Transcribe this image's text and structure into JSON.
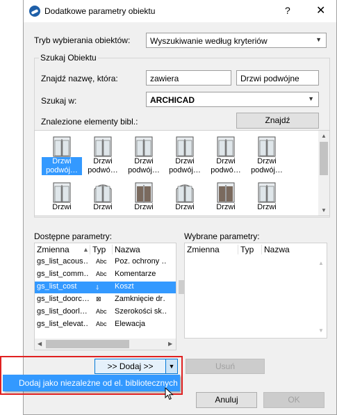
{
  "window": {
    "title": "Dodatkowe parametry obiektu",
    "help_label": "?",
    "close_label": "✕"
  },
  "selection_mode": {
    "label": "Tryb wybierania obiektów:",
    "value": "Wyszukiwanie według kryteriów"
  },
  "search_group": {
    "title": "Szukaj Obiektu",
    "find_name_label": "Znajdź nazwę, która:",
    "condition_value": "zawiera",
    "name_value": "Drzwi podwójne",
    "search_in_label": "Szukaj w:",
    "search_in_value": "ARCHICAD",
    "found_label": "Znalezione elementy bibl.:",
    "find_button": "Znajdź"
  },
  "library_items": [
    {
      "line1": "Drzwi",
      "line2": "podwój…",
      "selected": true,
      "icon": "double-door-icon"
    },
    {
      "line1": "Drzwi",
      "line2": "podwó…",
      "selected": false,
      "icon": "double-door-icon"
    },
    {
      "line1": "Drzwi",
      "line2": "podwój…",
      "selected": false,
      "icon": "double-door-icon"
    },
    {
      "line1": "Drzwi",
      "line2": "podwój…",
      "selected": false,
      "icon": "double-door-icon"
    },
    {
      "line1": "Drzwi",
      "line2": "podwó…",
      "selected": false,
      "icon": "double-door-icon"
    },
    {
      "line1": "Drzwi",
      "line2": "podwój…",
      "selected": false,
      "icon": "double-door-icon"
    },
    {
      "line1": "Drzwi",
      "line2": "",
      "selected": false,
      "icon": "double-door-icon"
    },
    {
      "line1": "Drzwi",
      "line2": "",
      "selected": false,
      "icon": "arched-door-icon"
    },
    {
      "line1": "Drzwi",
      "line2": "",
      "selected": false,
      "icon": "ornate-door-icon"
    },
    {
      "line1": "Drzwi",
      "line2": "",
      "selected": false,
      "icon": "arched-door-icon"
    },
    {
      "line1": "Drzwi",
      "line2": "",
      "selected": false,
      "icon": "ornate-door-icon"
    },
    {
      "line1": "Drzwi",
      "line2": "",
      "selected": false,
      "icon": "double-door-icon"
    }
  ],
  "available": {
    "title": "Dostępne parametry:",
    "columns": {
      "name": "Zmienna",
      "type": "Typ",
      "label": "Nazwa"
    },
    "rows": [
      {
        "name": "gs_list_acous…",
        "type": "Abc",
        "label": "Poz. ochrony …",
        "selected": false
      },
      {
        "name": "gs_list_comm…",
        "type": "Abc",
        "label": "Komentarze",
        "selected": false
      },
      {
        "name": "gs_list_cost",
        "type": "⸸",
        "label": "Koszt",
        "selected": true
      },
      {
        "name": "gs_list_doorc…",
        "type": "⊠",
        "label": "Zamknięcie dr…",
        "selected": false
      },
      {
        "name": "gs_list_doorl…",
        "type": "Abc",
        "label": "Szerokości sk…",
        "selected": false
      },
      {
        "name": "gs_list_elevat…",
        "type": "Abc",
        "label": "Elewacja",
        "selected": false
      }
    ]
  },
  "selected": {
    "title": "Wybrane parametry:",
    "columns": {
      "name": "Zmienna",
      "type": "Typ",
      "label": "Nazwa"
    }
  },
  "buttons": {
    "add": ">> Dodaj >>",
    "remove": "Usuń",
    "cancel": "Anuluj",
    "ok": "OK"
  },
  "add_menu": {
    "option": "Dodaj jako niezależne od el. bibliotecznych"
  }
}
